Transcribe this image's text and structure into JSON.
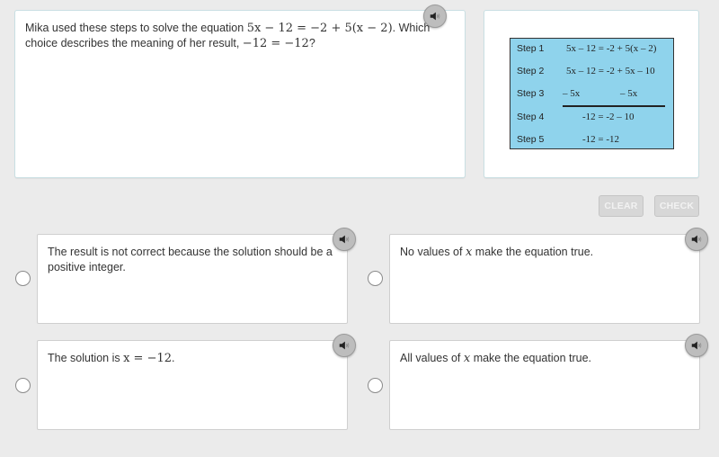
{
  "question": {
    "text_before": "Mika used these steps to solve the equation ",
    "equation": "5x − 12 = −2 + 5(x − 2)",
    "text_middle": ". Which choice describes the meaning of her result, ",
    "result": "−12 = −12",
    "text_after": "?",
    "audio_icon": "speaker-icon"
  },
  "steps_image": {
    "background_color": "#8fd3ec",
    "steps": [
      {
        "label": "Step 1",
        "equation": "5x – 12 = -2 + 5(x – 2)"
      },
      {
        "label": "Step 2",
        "equation": "5x – 12 = -2 + 5x – 10"
      },
      {
        "label": "Step 3",
        "left": "– 5x",
        "right": "– 5x"
      },
      {
        "label": "Step 4",
        "equation": "-12 = -2 – 10"
      },
      {
        "label": "Step 5",
        "equation": "-12 = -12"
      }
    ]
  },
  "toolbar": {
    "clear_label": "CLEAR",
    "check_label": "CHECK"
  },
  "choices": [
    {
      "text": "The result is not correct because the solution should be a positive integer.",
      "selected": false
    },
    {
      "text_before": "No values of ",
      "math": "x",
      "text_after": " make the equation true.",
      "selected": false
    },
    {
      "text_before": "The solution is ",
      "math": "x = −12",
      "text_after": ".",
      "selected": false
    },
    {
      "text_before": "All values of ",
      "math": "x",
      "text_after": " make the equation true.",
      "selected": false
    }
  ]
}
